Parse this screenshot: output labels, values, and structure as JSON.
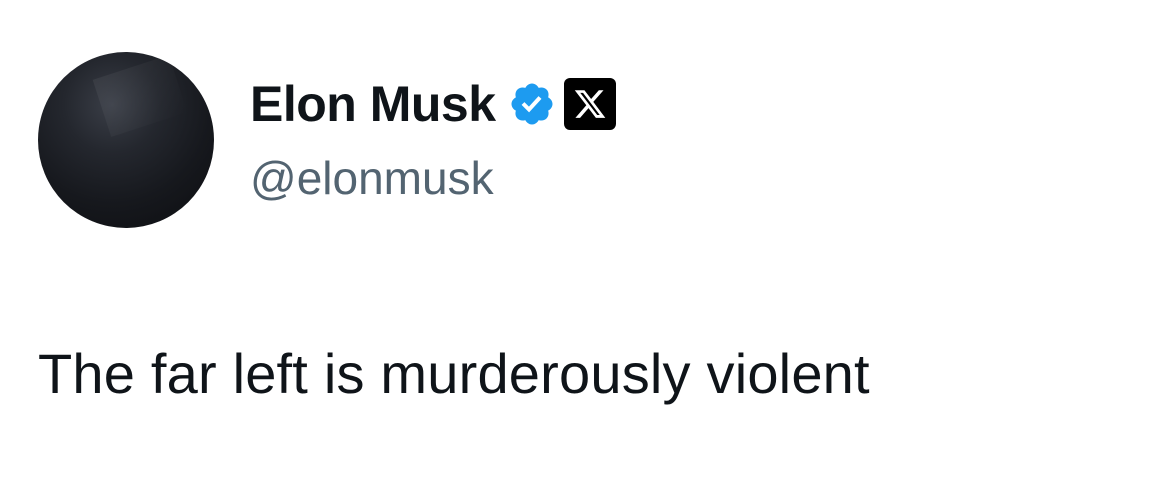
{
  "author": {
    "display_name": "Elon Musk",
    "handle": "@elonmusk",
    "avatar_icon": "avatar-image",
    "verified_icon": "verified-badge-icon",
    "affiliate_icon": "x-logo-icon"
  },
  "tweet": {
    "text": "The far left is murderously violent"
  },
  "colors": {
    "text_primary": "#0f1419",
    "text_secondary": "#536471",
    "verified_blue": "#1d9bf0",
    "background": "#ffffff"
  }
}
